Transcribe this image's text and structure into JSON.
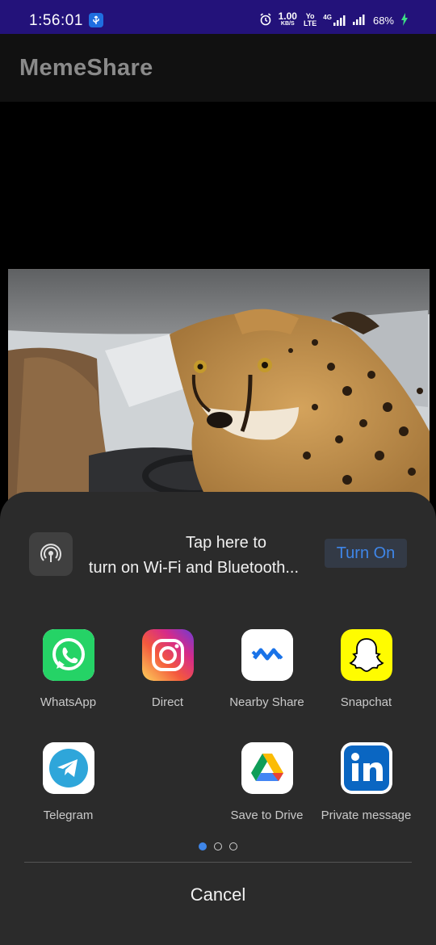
{
  "status_bar": {
    "time": "1:56:01",
    "net_speed_value": "1.00",
    "net_speed_unit": "KB/S",
    "volte_top": "Yo",
    "volte_bottom": "LTE",
    "network_type": "4G",
    "battery": "68%"
  },
  "app_bar": {
    "title": "MemeShare"
  },
  "share_sheet": {
    "wifi_prompt_line1": "Tap here to",
    "wifi_prompt_line2": "turn on Wi-Fi and Bluetooth...",
    "turn_on_label": "Turn On",
    "apps": [
      {
        "label": "WhatsApp",
        "icon": "whatsapp-icon"
      },
      {
        "label": "Direct",
        "icon": "instagram-icon"
      },
      {
        "label": "Nearby Share",
        "icon": "nearby-share-icon"
      },
      {
        "label": "Snapchat",
        "icon": "snapchat-icon"
      },
      {
        "label": "Telegram",
        "icon": "telegram-icon"
      },
      {
        "label": "Save to Drive",
        "icon": "google-drive-icon"
      },
      {
        "label": "Private message",
        "icon": "linkedin-icon"
      }
    ],
    "page_count": 3,
    "active_page": 1,
    "cancel_label": "Cancel"
  },
  "colors": {
    "status_bar_bg": "#23127a",
    "sheet_bg": "#2b2b2b",
    "accent": "#3f86e8"
  }
}
